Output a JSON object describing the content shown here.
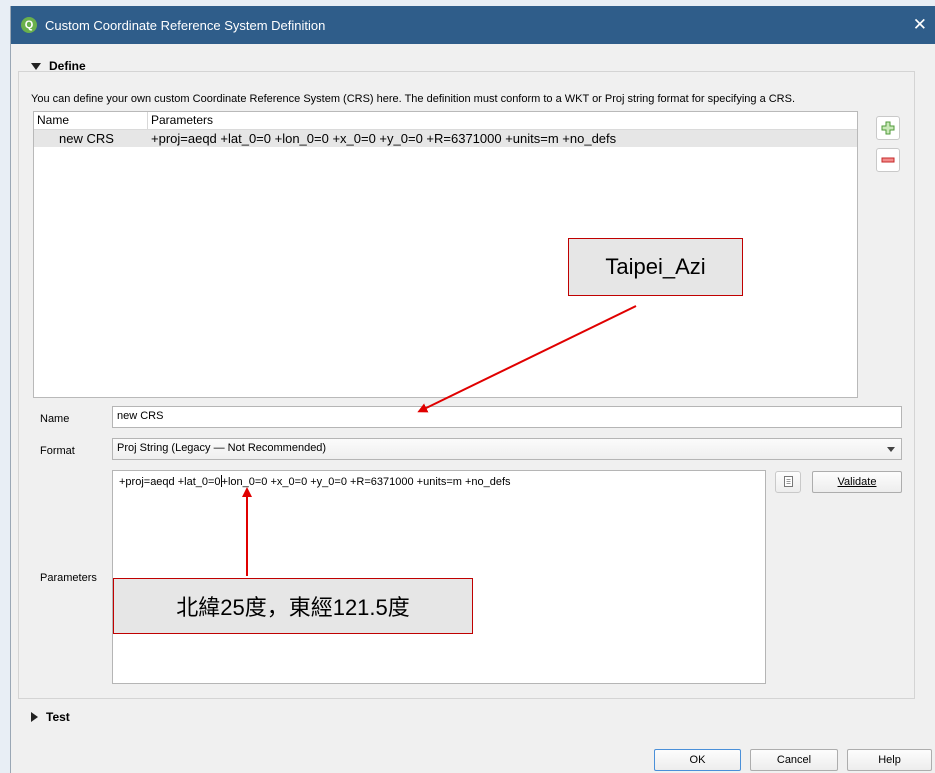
{
  "window": {
    "title": "Custom Coordinate Reference System Definition",
    "close_glyph": "✕"
  },
  "define": {
    "header": "Define",
    "description": "You can define your own custom Coordinate Reference System (CRS) here. The definition must conform to a WKT or Proj string format for specifying a CRS.",
    "table": {
      "columns": [
        "Name",
        "Parameters"
      ],
      "rows": [
        {
          "name": "new CRS",
          "parameters": "+proj=aeqd +lat_0=0 +lon_0=0 +x_0=0 +y_0=0 +R=6371000 +units=m +no_defs"
        }
      ]
    },
    "add_icon": "plus-icon",
    "remove_icon": "minus-icon",
    "name_label": "Name",
    "name_value": "new CRS",
    "format_label": "Format",
    "format_value": "Proj String (Legacy — Not Recommended)",
    "parameters_label": "Parameters",
    "params_part1": "+proj=aeqd +lat_0=0",
    "params_part2": "+lon_0=0 +x_0=0 +y_0=0 +R=6371000 +units=m +no_defs",
    "copy_icon": "copy-icon",
    "validate_label": "Validate"
  },
  "test": {
    "header": "Test"
  },
  "buttons": {
    "ok": "OK",
    "cancel": "Cancel",
    "help": "Help"
  },
  "annotations": {
    "callout_name": "Taipei_Azi",
    "callout_params": "北緯25度，東經121.5度",
    "arrow_color": "#e00000"
  }
}
